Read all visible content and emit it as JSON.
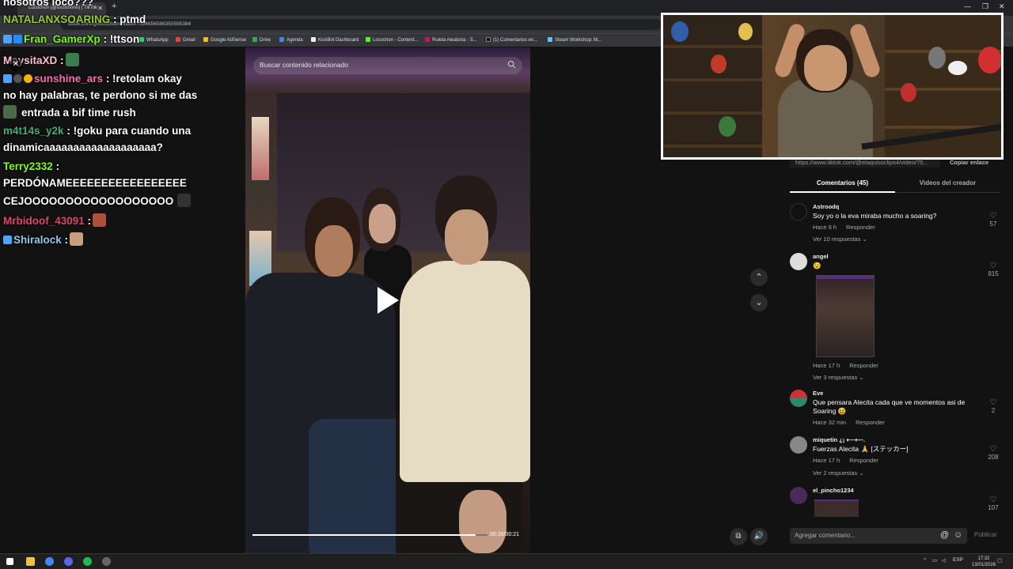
{
  "browser": {
    "tab_title": "Locochon (@locochonn) | TikTok",
    "url": "tiktok.com/@locochonn/video/7594656586350595384",
    "bookmarks": [
      "WhatsApp",
      "Gmail",
      "Google AdSense",
      "Drive",
      "Agenda",
      "KickBot Dashboard",
      "Locochon - Content...",
      "Ruleta Aleatoria - S...",
      "(1) Comentarios en...",
      "Steam Workshop::M..."
    ]
  },
  "video": {
    "search_placeholder": "Buscar contenido relacionado",
    "time": "00:20/00:21",
    "progress": 0.95
  },
  "panel": {
    "link": "https://www.tiktok.com/@elaquisoclips4/video/75...",
    "copy_label": "Copiar enlace",
    "tab_comments": "Comentarios (45)",
    "tab_creator": "Videos del creador",
    "add_comment_placeholder": "Agregar comentario...",
    "publish_label": "Publicar",
    "comments": [
      {
        "user": "Astroodq",
        "text": "Soy yo o la eva miraba mucho a soaring?",
        "time": "Hace 9 h",
        "reply": "Responder",
        "more": "Ver 10 respuestas ⌄",
        "likes": "57"
      },
      {
        "user": "angel",
        "text": "😉",
        "time": "Hace 17 h",
        "reply": "Responder",
        "more": "Ver 3 respuestas ⌄",
        "likes": "815"
      },
      {
        "user": "Eve",
        "text": "Que pensara Alecita cada que ve momentos asi de Soaring 😆",
        "time": "Hace 32 min",
        "reply": "Responder",
        "more": "",
        "likes": "2"
      },
      {
        "user": "miquetin ¿¡ ⟵⟵.",
        "text": "Fuerzas Alecita 🙏 [ステッカー]",
        "time": "Hace 17 h",
        "reply": "Responder",
        "more": "Ver 2 respuestas ⌄",
        "likes": "208"
      },
      {
        "user": "el_pincho1234",
        "text": "",
        "time": "",
        "reply": "",
        "more": "",
        "likes": "107"
      }
    ]
  },
  "chat": [
    {
      "name": "nosotros loco???",
      "msg": "",
      "color": "#ffffff"
    },
    {
      "name": "NATALANXSOARING",
      "msg": ": ptmd",
      "color": "#9acd32"
    },
    {
      "name": "Fran_GamerXp",
      "msg": ": !ttson",
      "color": "#7cfc00"
    },
    {
      "name": "MaysitaXD",
      "msg": ":",
      "color": "#ffc0cb"
    },
    {
      "name": "sunshine_ars",
      "msg": ": !retolam okay",
      "color": "#ff69b4"
    },
    {
      "name": "no hay palabras, te perdono si me das",
      "msg": "",
      "color": "#ffffff"
    },
    {
      "name": "entrada a bif time rush",
      "msg": "",
      "color": "#ffffff"
    },
    {
      "name": "m4t14s_y2k",
      "msg": ": !goku para cuando una",
      "color": "#3cb371"
    },
    {
      "name": "dinamicaaaaaaaaaaaaaaaaaaa?",
      "msg": "",
      "color": "#ffffff"
    },
    {
      "name": "Terry2332",
      "msg": ":",
      "color": "#7fff00"
    },
    {
      "name": "PERDÓNAMEEEEEEEEEEEEEEEEE",
      "msg": "",
      "color": "#ffffff"
    },
    {
      "name": "CEJOOOOOOOOOOOOOOOOOO",
      "msg": "",
      "color": "#ffffff"
    },
    {
      "name": "Mrbidoof_43091",
      "msg": ":",
      "color": "#e0486a"
    },
    {
      "name": "Shiralock",
      "msg": ":",
      "color": "#87ceeb"
    }
  ],
  "taskbar": {
    "lang": "ESP",
    "time": "17:32",
    "date": "13/01/2026"
  },
  "colors": {
    "accent": "#fe2c55",
    "background": "#121212"
  }
}
